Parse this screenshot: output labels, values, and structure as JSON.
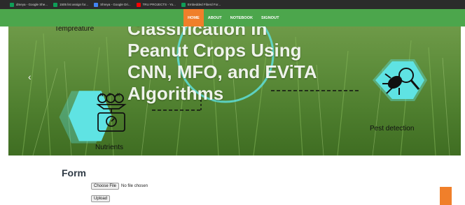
{
  "bookmarks": [
    {
      "label": "dmeya - Google She...",
      "color": "#0f9d58"
    },
    {
      "label": "1505 list assign for...",
      "color": "#0f9d58"
    },
    {
      "label": "Shreya - Google Dri...",
      "color": "#4285f4"
    },
    {
      "label": "TRU PROJECTS - Yo...",
      "color": "#ff0000"
    },
    {
      "label": "Embedded Fiberd For...",
      "color": "#0f9d58"
    }
  ],
  "nav": {
    "items": [
      {
        "label": "HOME",
        "active": true
      },
      {
        "label": "ABOUT",
        "active": false
      },
      {
        "label": "NOTEBOOK",
        "active": false
      },
      {
        "label": "SIGNOUT",
        "active": false
      }
    ]
  },
  "hero": {
    "title_lines": [
      "Classification in",
      "Peanut Crops Using",
      "CNN, MFO, and EViTA",
      "Algorithms"
    ],
    "labels": {
      "temperature": "Tempreature",
      "nutrients": "Nutrients",
      "pest": "Pest detection"
    },
    "npk_letters": [
      "N",
      "P",
      "K"
    ],
    "prev_arrow": "‹",
    "hex_color": "#5fe3e3"
  },
  "form": {
    "title": "Form",
    "choose_label": "Choose File",
    "no_file_text": "No file chosen",
    "upload_label": "Upload"
  },
  "colors": {
    "navbar": "#4ca64c",
    "accent": "#f07f2a"
  }
}
